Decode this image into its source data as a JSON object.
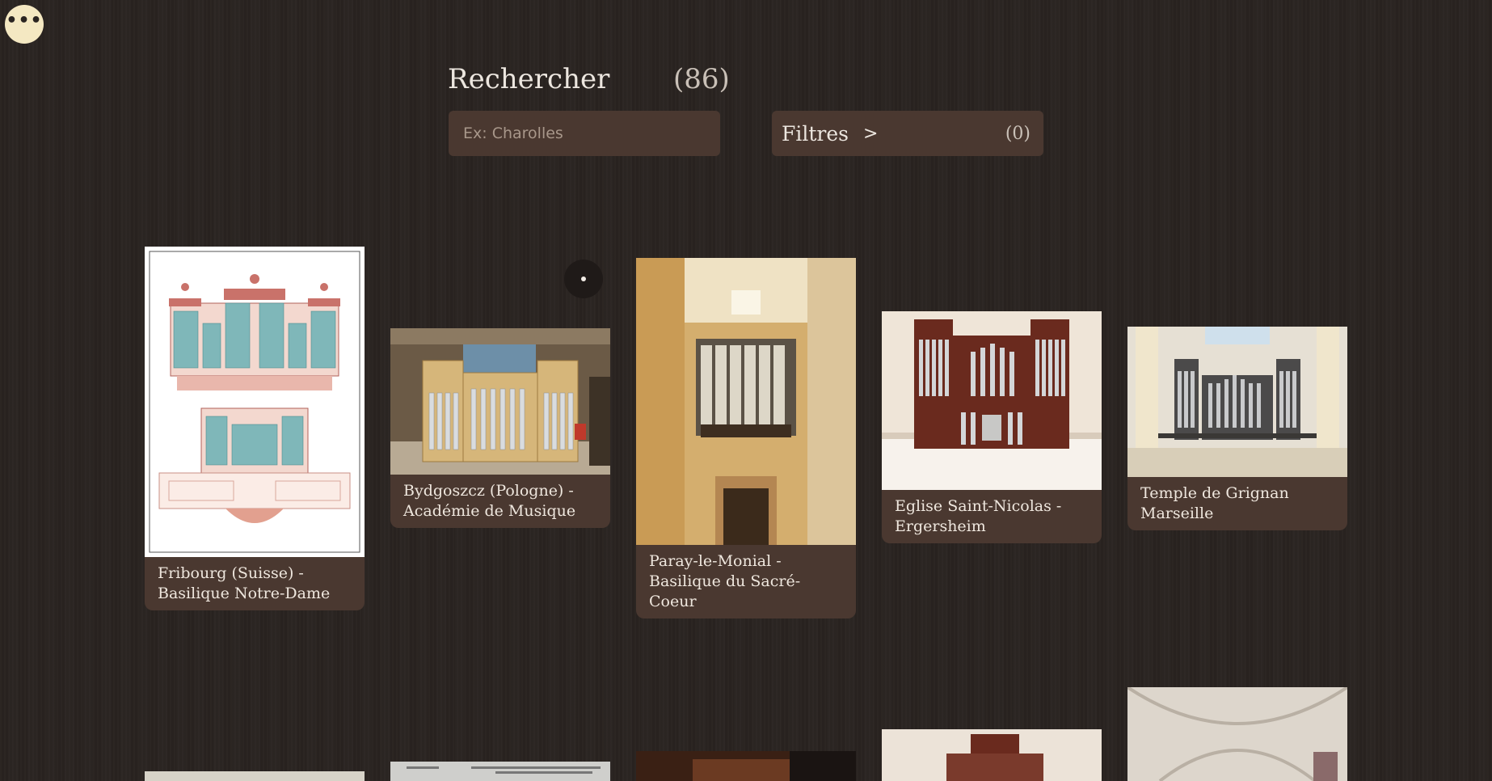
{
  "menu": {
    "icon": "more-dots-icon",
    "glyph": "•••"
  },
  "search": {
    "title": "Rechercher",
    "count": "(86)",
    "placeholder": "Ex: Charolles"
  },
  "filters": {
    "label": "Filtres",
    "arrow": ">",
    "count": "(0)"
  },
  "cards": [
    {
      "line1": "Fribourg (Suisse) -",
      "line2": "Basilique Notre-Dame"
    },
    {
      "line1": "Bydgoszcz (Pologne) -",
      "line2": "Académie de Musique"
    },
    {
      "line1": "Paray-le-Monial -",
      "line2": "Basilique du Sacré-Coeur"
    },
    {
      "line1": "Eglise Saint-Nicolas -",
      "line2": "Ergersheim"
    },
    {
      "line1": "Temple de Grignan",
      "line2": "Marseille"
    }
  ]
}
